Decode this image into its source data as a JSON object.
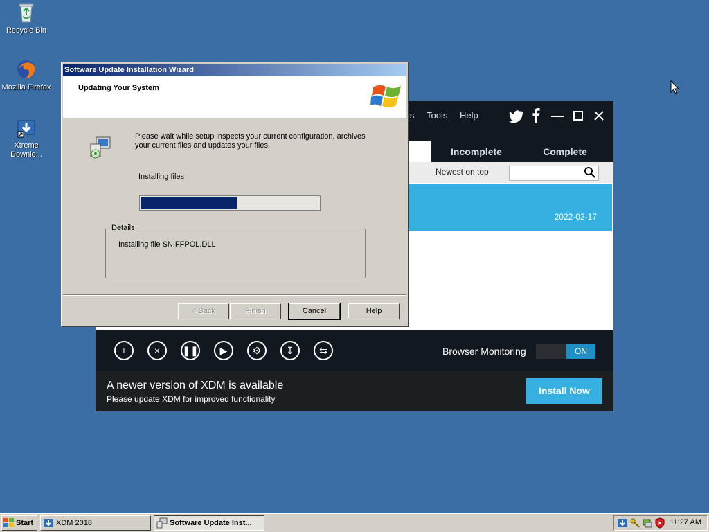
{
  "desktop": {
    "icons": [
      {
        "label": "Recycle Bin",
        "icon": "recycle-bin-icon"
      },
      {
        "label": "Mozilla Firefox",
        "icon": "firefox-icon"
      },
      {
        "label": "Xtreme Downlo...",
        "icon": "xdm-icon"
      }
    ]
  },
  "xdm": {
    "menu": [
      "ls",
      "Tools",
      "Help"
    ],
    "tabs": [
      "Incomplete",
      "Complete"
    ],
    "sort_label": "Newest on top",
    "search": {
      "value": "",
      "icon": "search-icon"
    },
    "selected_row": {
      "date": "2022-02-17"
    },
    "toolbar_icons": [
      "add-icon",
      "delete-icon",
      "pause-icon",
      "resume-icon",
      "settings-icon",
      "download-icon",
      "sync-icon"
    ],
    "browser_monitoring": {
      "label": "Browser Monitoring",
      "state": "ON"
    },
    "update": {
      "title": "A newer version of XDM is available",
      "subtitle": "Please update XDM for improved functionality",
      "button": "Install Now"
    },
    "colors": {
      "accent": "#35b0e0",
      "dark": "#111820"
    }
  },
  "wizard": {
    "title": "Software Update Installation Wizard",
    "header": "Updating Your System",
    "message": "Please wait while setup inspects your current configuration, archives your current files and updates your files.",
    "status": "Installing files",
    "progress": 0.54,
    "details_label": "Details",
    "details_text": "Installing file SNIFFPOL.DLL",
    "buttons": {
      "back": "< Back",
      "finish": "Finish",
      "cancel": "Cancel",
      "help": "Help"
    }
  },
  "taskbar": {
    "start": "Start",
    "tasks": [
      {
        "label": "XDM 2018",
        "active": false
      },
      {
        "label": "Software Update Inst...",
        "active": true
      }
    ],
    "clock": "11:27 AM"
  }
}
